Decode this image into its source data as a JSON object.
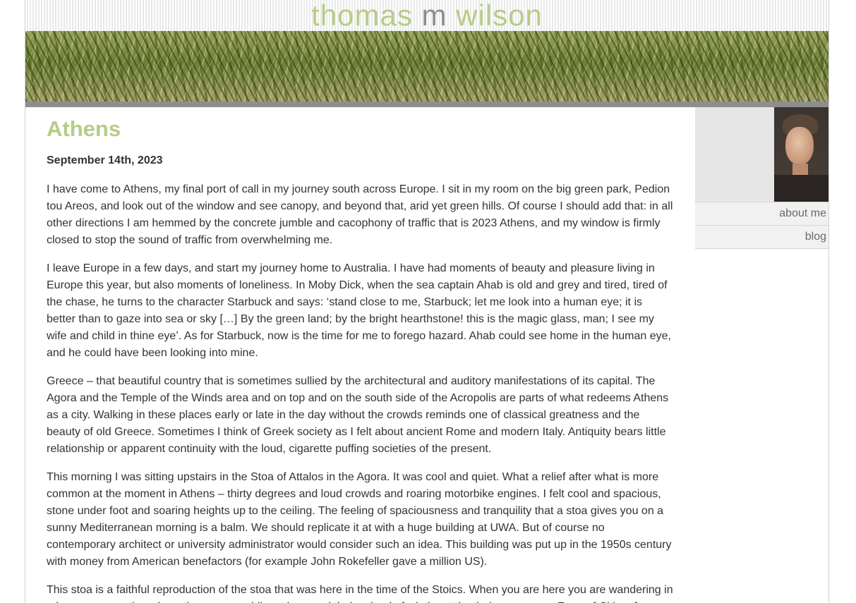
{
  "site": {
    "title_first": "thomas",
    "title_middle": "m",
    "title_last": "wilson"
  },
  "post": {
    "title": "Athens",
    "date": "September 14th, 2023",
    "paragraphs": [
      "I have come to Athens, my final port of call in my journey south across Europe. I sit in my room on the big green park, Pedion tou Areos, and look out of the window and see canopy, and beyond that, arid yet green hills. Of course I should add that: in all other directions I am hemmed by the concrete jumble and cacophony of traffic that is 2023 Athens, and my window is firmly closed to stop the sound of traffic from overwhelming me.",
      "I leave Europe in a few days, and start my journey home to Australia. I have had moments of beauty and pleasure living in Europe this year, but also moments of loneliness. In Moby Dick, when the sea captain Ahab is old and grey and tired, tired of the chase, he turns to the character Starbuck and says: ‘stand close to me, Starbuck; let me look into a human eye; it is better than to gaze into sea or sky […] By the green land; by the bright hearthstone! this is the magic glass, man; I see my wife and child in thine eye’. As for Starbuck, now is the time for me to forego hazard. Ahab could see home in the human eye, and he could have been looking into mine.",
      "Greece – that beautiful country that is sometimes sullied by the architectural and auditory manifestations of its capital.  The Agora and the Temple of the Winds area and on top and on the south side of the Acropolis are parts of what redeems Athens as a city.  Walking in these places early or late in the day without the crowds reminds one of classical greatness and the beauty of old Greece.  Sometimes I think of Greek society as I felt about ancient Rome and modern Italy. Antiquity bears little relationship or apparent continuity with the loud, cigarette puffing societies of the present.",
      "This morning I was sitting upstairs in the Stoa of Attalos in the Agora.  It was cool and quiet.  What a relief after what is more common at the moment in Athens – thirty degrees and loud crowds and roaring motorbike engines.  I felt cool and spacious, stone under foot and soaring heights up to the ceiling.  The feeling of spaciousness and tranquility that a stoa gives you on a sunny Mediterranean morning is a balm.  We should replicate it at with a huge building at UWA.  But of course no contemporary architect or university administrator would consider such an idea.  This building was put up in the 1950s century with money from American benefactors (for example John Rokefeller gave a million US).",
      "This stoa is a faithful reproduction of the stoa that was here in the time of the Stoics. When you are here you are wandering in a large open portico where those same philosophers and their school of wisdom take their very name. Zeno of Citium for"
    ]
  },
  "sidebar": {
    "nav": [
      {
        "label": "about me"
      },
      {
        "label": "blog"
      }
    ]
  }
}
